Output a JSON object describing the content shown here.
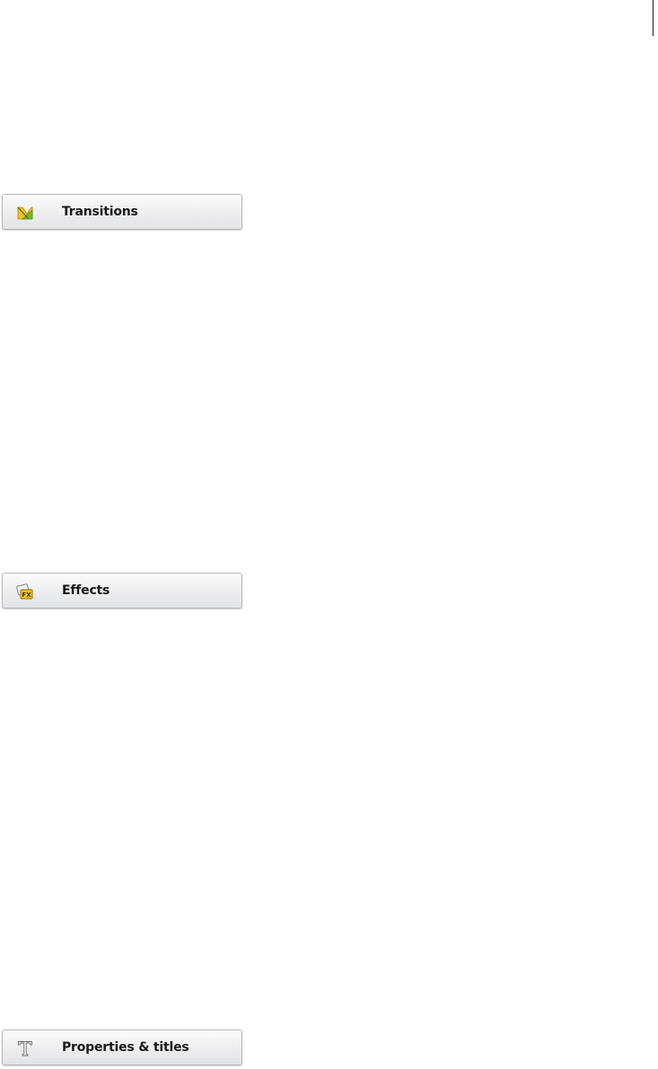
{
  "panels": [
    {
      "label": "Transitions",
      "icon": "transition-icon"
    },
    {
      "label": "Effects",
      "icon": "fx-effects-icon"
    },
    {
      "label": "Properties & titles",
      "icon": "text-t-icon"
    }
  ],
  "colors": {
    "button_border": "#b3b6ba",
    "button_gradient_top": "#fbfbfc",
    "button_gradient_bottom": "#e1e4e7",
    "label_text": "#1b1b1b",
    "transition_icon_yellow": "#f2c21b",
    "transition_icon_green": "#7ab92c",
    "fx_icon_yellow": "#f3c318"
  }
}
